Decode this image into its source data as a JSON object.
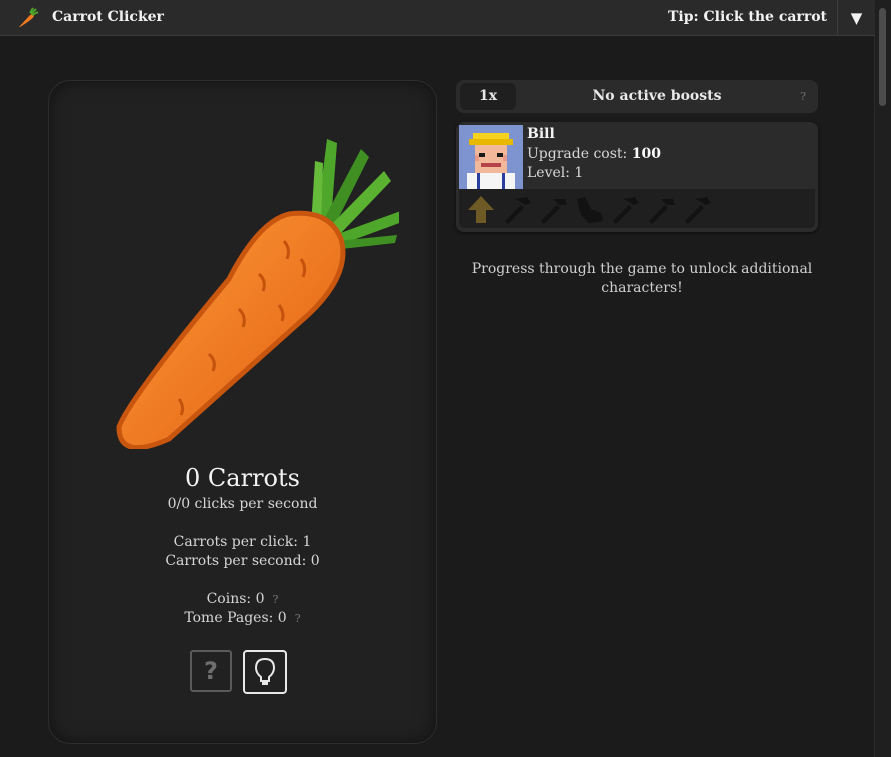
{
  "header": {
    "app_title": "Carrot Clicker",
    "tip": "Tip: Click the carrot",
    "menu_icon": "triangle-down-icon"
  },
  "main": {
    "carrot_count": "0 Carrots",
    "clicks_per_second": "0/0 clicks per second",
    "carrots_per_click": "Carrots per click: 1",
    "carrots_per_second": "Carrots per second: 0",
    "coins": "Coins: 0",
    "tome_pages": "Tome Pages: 0",
    "help_mark": "?",
    "help_button_label": "?"
  },
  "boosts": {
    "multiplier": "1x",
    "status": "No active boosts",
    "help_mark": "?"
  },
  "character": {
    "name": "Bill",
    "upgrade_cost_label": "Upgrade cost:",
    "upgrade_cost_value": "100",
    "level": "Level: 1",
    "tools": [
      "upgrade-arrow-icon",
      "hoe-icon",
      "hoe-icon",
      "boot-icon",
      "hoe-icon",
      "hoe-icon",
      "hoe-icon"
    ]
  },
  "unlock_message": "Progress through the game to unlock additional characters!",
  "colors": {
    "background": "#1b1b1b",
    "panel": "#222121",
    "carrot_orange": "#f07a22",
    "leaf_green": "#4ea62a"
  }
}
